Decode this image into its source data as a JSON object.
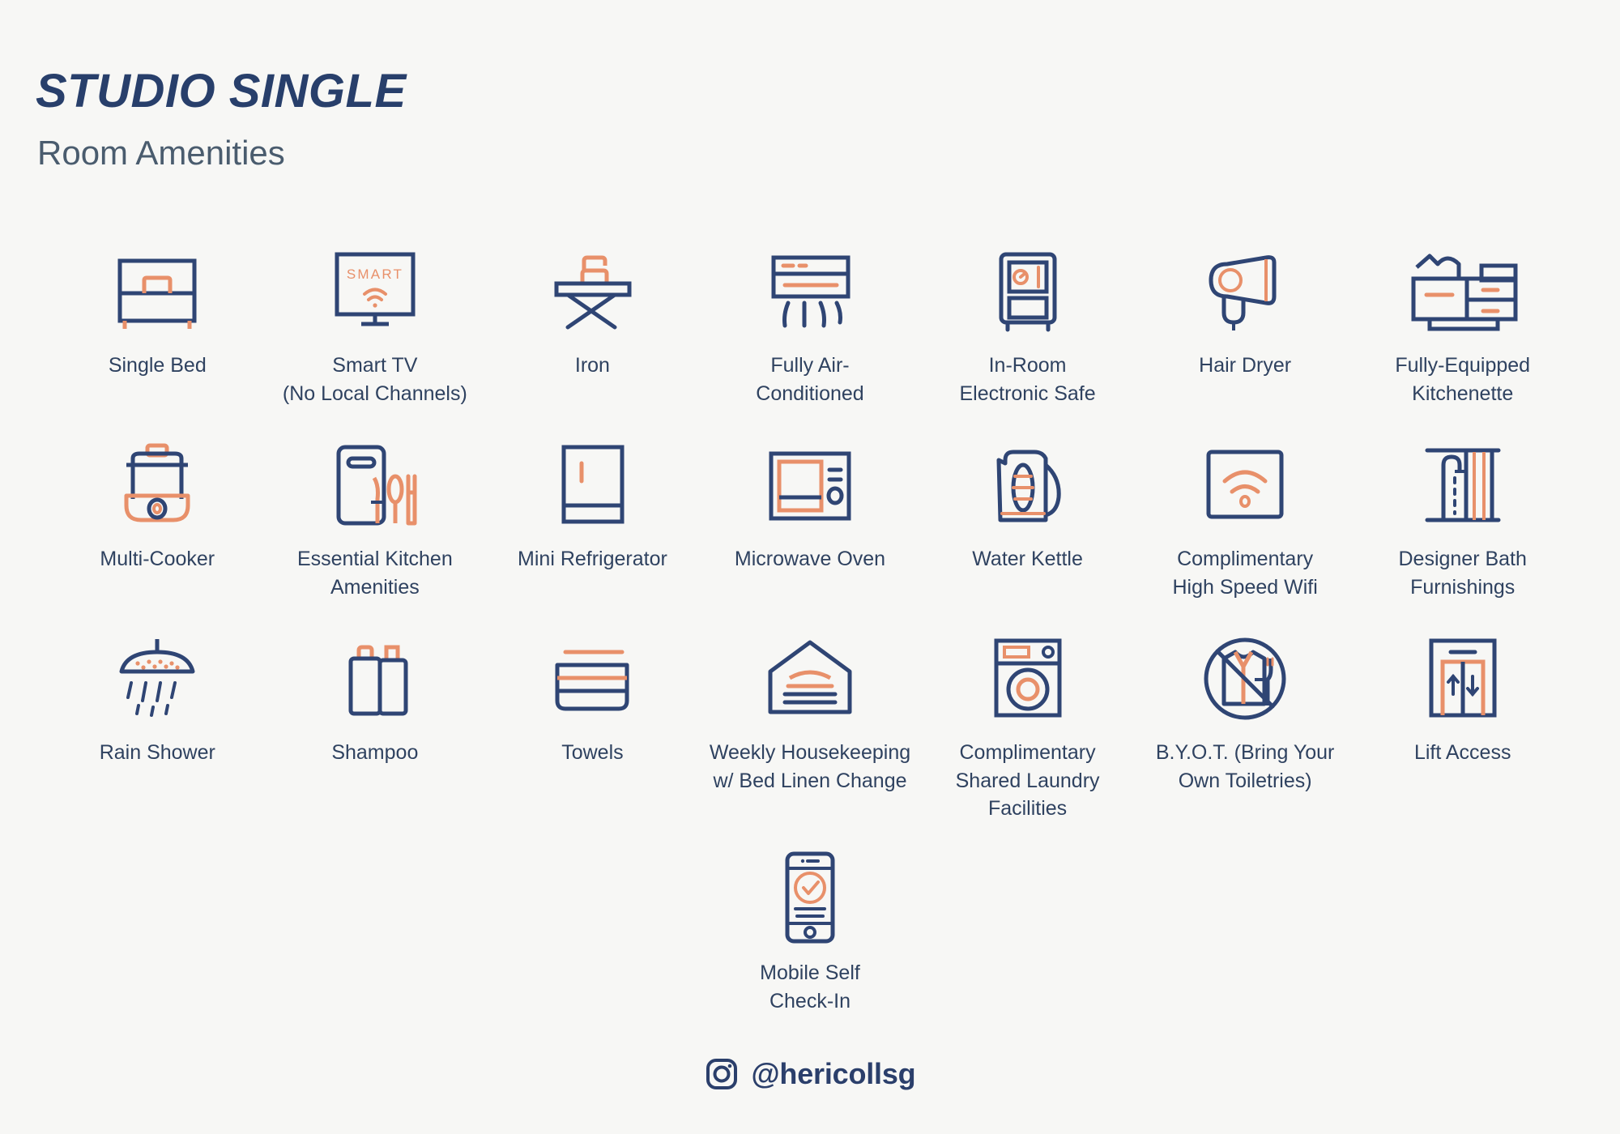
{
  "header": {
    "title": "STUDIO SINGLE",
    "subtitle": "Room Amenities"
  },
  "colors": {
    "background": "#f7f7f5",
    "navy": "#2f4574",
    "navy_text": "#2f4260",
    "orange": "#e8906a",
    "title_navy": "#283f6b"
  },
  "grid": {
    "columns": 7,
    "rows": 3,
    "items": [
      {
        "icon": "single-bed-icon",
        "label": "Single Bed"
      },
      {
        "icon": "smart-tv-icon",
        "label": "Smart TV\n(No Local Channels)",
        "icon_text": "SMART"
      },
      {
        "icon": "iron-icon",
        "label": "Iron"
      },
      {
        "icon": "air-conditioner-icon",
        "label": "Fully Air-\nConditioned"
      },
      {
        "icon": "electronic-safe-icon",
        "label": "In-Room\nElectronic Safe"
      },
      {
        "icon": "hair-dryer-icon",
        "label": "Hair Dryer"
      },
      {
        "icon": "kitchenette-icon",
        "label": "Fully-Equipped\nKitchenette"
      },
      {
        "icon": "multi-cooker-icon",
        "label": "Multi-Cooker"
      },
      {
        "icon": "kitchen-utensils-icon",
        "label": "Essential Kitchen\nAmenities"
      },
      {
        "icon": "mini-refrigerator-icon",
        "label": "Mini Refrigerator"
      },
      {
        "icon": "microwave-oven-icon",
        "label": "Microwave Oven"
      },
      {
        "icon": "water-kettle-icon",
        "label": "Water Kettle"
      },
      {
        "icon": "wifi-icon",
        "label": "Complimentary\nHigh Speed Wifi"
      },
      {
        "icon": "shower-curtain-icon",
        "label": "Designer Bath\nFurnishings"
      },
      {
        "icon": "rain-shower-icon",
        "label": "Rain Shower"
      },
      {
        "icon": "shampoo-bottles-icon",
        "label": "Shampoo"
      },
      {
        "icon": "towels-icon",
        "label": "Towels"
      },
      {
        "icon": "housekeeping-bed-icon",
        "label": "Weekly Housekeeping\nw/ Bed Linen Change"
      },
      {
        "icon": "washing-machine-icon",
        "label": "Complimentary\nShared Laundry\nFacilities"
      },
      {
        "icon": "no-toiletries-icon",
        "label": "B.Y.O.T. (Bring Your\nOwn Toiletries)"
      },
      {
        "icon": "lift-icon",
        "label": "Lift Access"
      }
    ]
  },
  "single_item": {
    "icon": "mobile-checkin-icon",
    "label": "Mobile Self\nCheck-In"
  },
  "footer": {
    "icon": "instagram-icon",
    "handle": "@hericollsg"
  }
}
